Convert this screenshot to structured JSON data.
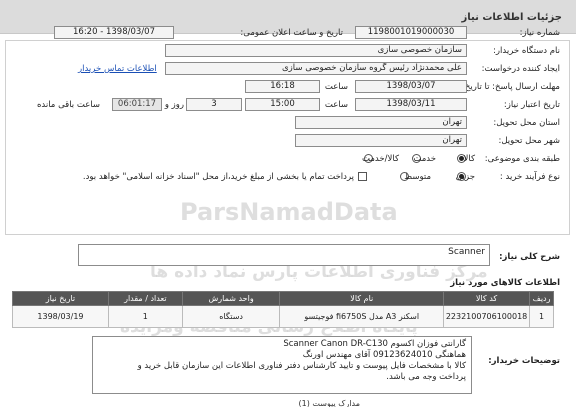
{
  "header": {
    "title": "جزئیات اطلاعات نیاز"
  },
  "form": {
    "need_number": {
      "label": "شماره نیاز:",
      "value": "1198001019000030"
    },
    "announce": {
      "label": "تاریخ و ساعت اعلان عمومی:",
      "value": "1398/03/07 - 16:20"
    },
    "buyer_org": {
      "label": "نام دستگاه خریدار:",
      "value": "سازمان خصوصی سازی"
    },
    "requester": {
      "label": "ایجاد کننده درخواست:",
      "value": "علی محمدنژاد رئیس گروه سازمان خصوصی سازی",
      "contact_link": "اطلاعات تماس خریدار"
    },
    "reply_deadline": {
      "label": "مهلت ارسال پاسخ: تا تاریخ:",
      "date": "1398/03/07",
      "time_label": "ساعت",
      "time": "16:18"
    },
    "validity": {
      "label": "تاریخ اعتبار نیاز:",
      "date": "1398/03/11",
      "time_label": "ساعت",
      "time": "15:00",
      "days": "3",
      "days_label": "روز و",
      "remaining": "06:01:17",
      "remaining_label": "ساعت باقی مانده"
    },
    "province": {
      "label": "استان محل تحویل:",
      "value": "تهران"
    },
    "city": {
      "label": "شهر محل تحویل:",
      "value": "تهران"
    },
    "category": {
      "label": "طبقه بندی موضوعی:",
      "options": [
        "کالا",
        "خدمت",
        "کالا/خدمت"
      ],
      "selected": "کالا"
    },
    "process": {
      "label": "نوع فرآیند خرید :",
      "options": [
        "جزیی",
        "متوسط"
      ],
      "selected": "جزیی",
      "note": "پرداخت تمام یا بخشی از مبلغ خرید،از محل \"اسناد خزانه اسلامی\" خواهد بود."
    }
  },
  "need_summary": {
    "label": "شرح کلی نیاز:",
    "value": "Scanner"
  },
  "items": {
    "title": "اطلاعات کالاهای مورد نیاز",
    "columns": [
      "ردیف",
      "کد کالا",
      "نام کالا",
      "واحد شمارش",
      "تعداد / مقدار",
      "تاریخ نیاز"
    ],
    "rows": [
      {
        "row": "1",
        "code": "2232100706100018",
        "name": "اسکنر A3 مدل fi6750S فوجیتسو",
        "unit": "دستگاه",
        "qty": "1",
        "date": "1398/03/19"
      }
    ]
  },
  "buyer_notes": {
    "label": "توضیحات خریدار:",
    "lines": [
      "گارانتی فوزان اکسوم Scanner Canon DR-C130",
      "هماهنگی 09123624010 آقای مهندس اورنگ",
      "کالا با مشخصات فایل پیوست و  تایید کارشناس دفتر فناوری اطلاعات این سازمان قابل خرید و",
      "پرداخت وجه می باشد."
    ]
  },
  "footer": {
    "attachments": "مدارک پیوست (1)"
  },
  "watermark": {
    "top": "ParsNamadData",
    "mid": "مرکز فناوری اطلاعات پارس نماد داده ها",
    "bottom": "پایگاه اطلاع رسانی مناقصه ومزایده"
  }
}
